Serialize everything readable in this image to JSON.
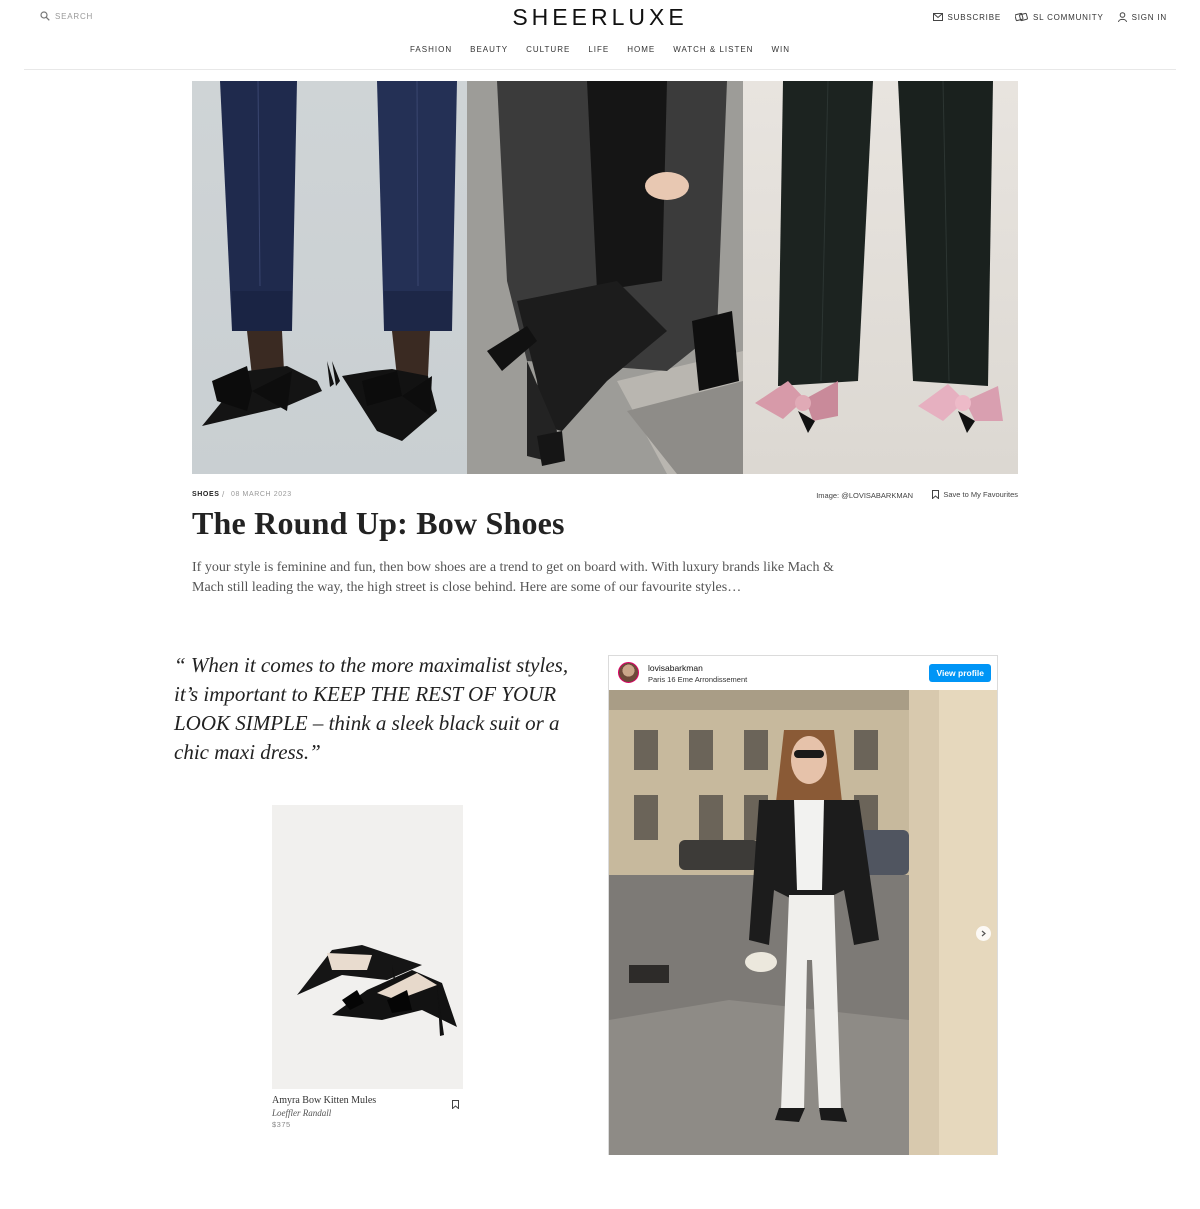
{
  "header": {
    "logo": "SHEERLUXE",
    "search_label": "SEARCH",
    "utility": [
      {
        "label": "SUBSCRIBE",
        "icon": "mail-icon"
      },
      {
        "label": "SL COMMUNITY",
        "icon": "community-icon"
      },
      {
        "label": "SIGN IN",
        "icon": "user-icon"
      }
    ],
    "nav": [
      "FASHION",
      "BEAUTY",
      "CULTURE",
      "LIFE",
      "HOME",
      "WATCH & LISTEN",
      "WIN"
    ]
  },
  "article": {
    "category": "SHOES",
    "separator": "/",
    "date": "08 MARCH 2023",
    "image_credit": "Image: @LOVISABARKMAN",
    "save_label": "Save to My Favourites",
    "title": "The Round Up: Bow Shoes",
    "standfirst": "If your style is feminine and fun, then bow shoes are a trend to get on board with. With luxury brands like Mach & Mach still leading the way, the high street is close behind. Here are some of our favourite styles…",
    "quote": "“ When it comes to the more maximalist styles, it’s important to KEEP THE REST OF YOUR LOOK SIMPLE – think a sleek black suit or a chic maxi dress.”"
  },
  "product": {
    "name": "Amyra Bow Kitten Mules",
    "brand": "Loeffler Randall",
    "price": "$375"
  },
  "instagram": {
    "username": "lovisabarkman",
    "location": "Paris 16 Eme Arrondissement",
    "button": "View profile"
  },
  "colors": {
    "accent_blue": "#0095f6",
    "text": "#222222",
    "muted": "#999999"
  }
}
